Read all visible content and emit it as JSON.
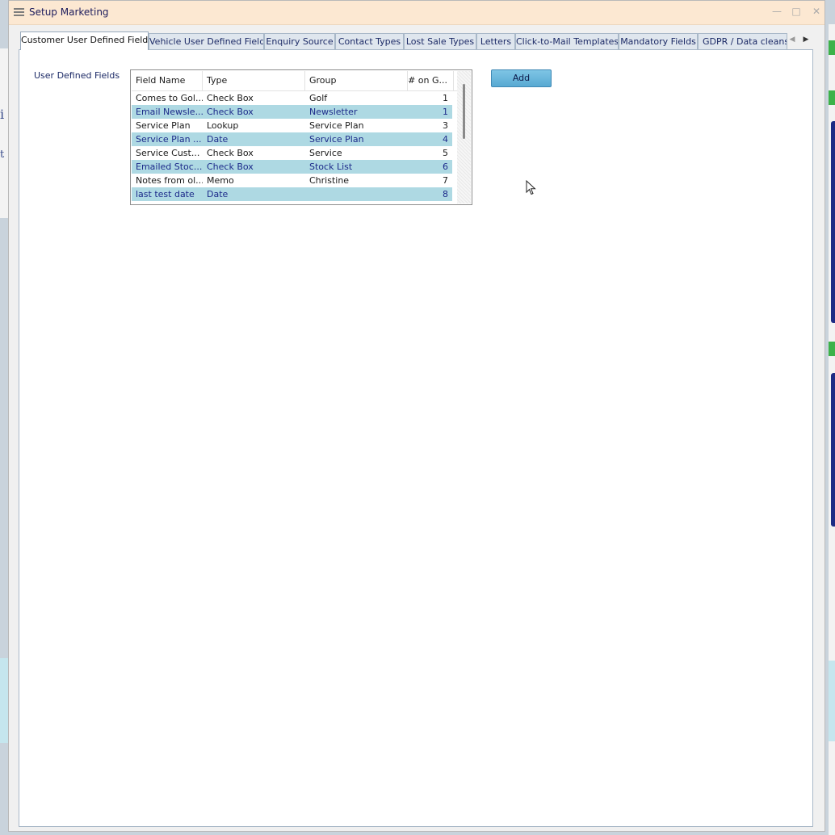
{
  "window": {
    "title": "Setup Marketing",
    "buttons": {
      "minimize": "—",
      "maximize": "□",
      "close": "✕"
    }
  },
  "tabs": [
    {
      "label": "Customer User Defined Fields",
      "active": true
    },
    {
      "label": "Vehicle User Defined Fields",
      "active": false
    },
    {
      "label": "Enquiry Source",
      "active": false
    },
    {
      "label": "Contact Types",
      "active": false
    },
    {
      "label": "Lost Sale Types",
      "active": false
    },
    {
      "label": "Letters",
      "active": false
    },
    {
      "label": "Click-to-Mail Templates",
      "active": false
    },
    {
      "label": "Mandatory Fields",
      "active": false
    },
    {
      "label": "GDPR / Data cleansin",
      "active": false
    }
  ],
  "tab_scroll": {
    "left": "◀",
    "right": "▶"
  },
  "panel": {
    "label": "User Defined Fields",
    "add_button": "Add"
  },
  "grid": {
    "columns": [
      "Field Name",
      "Type",
      "Group",
      "# on G..."
    ],
    "rows": [
      {
        "name": "Comes to Gol...",
        "type": "Check Box",
        "group": "Golf",
        "num": "1"
      },
      {
        "name": "Email Newsle...",
        "type": "Check Box",
        "group": "Newsletter",
        "num": "1"
      },
      {
        "name": "Service Plan",
        "type": "Lookup",
        "group": "Service Plan",
        "num": "3"
      },
      {
        "name": "Service Plan ...",
        "type": "Date",
        "group": "Service Plan",
        "num": "4"
      },
      {
        "name": "Service Cust...",
        "type": "Check Box",
        "group": "Service",
        "num": "5"
      },
      {
        "name": "Emailed Stoc...",
        "type": "Check Box",
        "group": "Stock List",
        "num": "6"
      },
      {
        "name": "Notes from ol...",
        "type": "Memo",
        "group": "Christine",
        "num": "7"
      },
      {
        "name": "last test date",
        "type": "Date",
        "group": "",
        "num": "8"
      }
    ]
  },
  "colors": {
    "title_bar": "#fce8d2",
    "row_highlight": "#aed9e3",
    "button": "#6bb8de"
  }
}
